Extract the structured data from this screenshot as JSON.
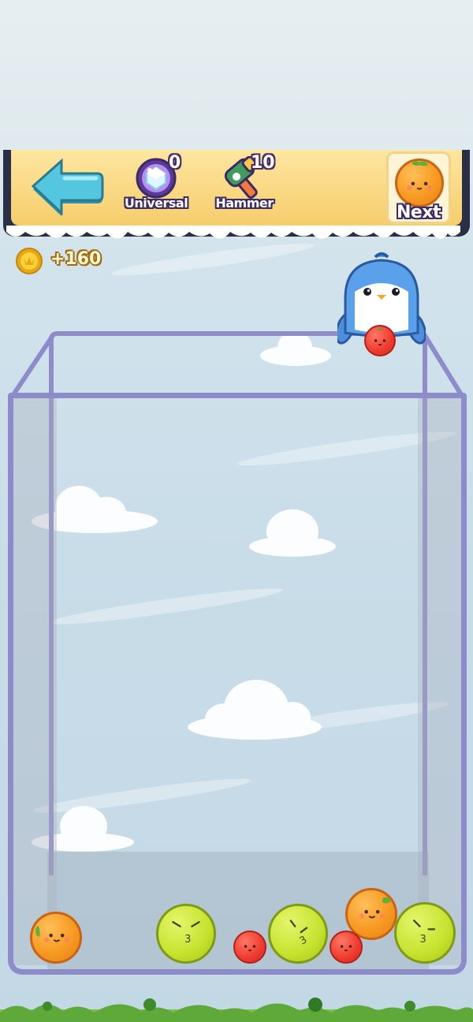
{
  "toolbar": {
    "back_icon": "back-arrow-icon",
    "universal": {
      "label": "Universal",
      "count": "0",
      "icon": "universal-crystal-icon"
    },
    "hammer": {
      "label": "Hammer",
      "count": "10",
      "icon": "hammer-icon"
    },
    "next": {
      "label": "Next",
      "fruit": "orange"
    }
  },
  "score": {
    "value": "+160",
    "icon": "gold-coin-icon"
  },
  "dropper": {
    "character": "penguin",
    "held_fruit": "tomato"
  },
  "colors": {
    "panel": "#f6cd6c",
    "panel_border": "#2b2f45",
    "jar": "#8d8bc9",
    "orange": "#f79a22",
    "tomato": "#ee3b2e",
    "lime": "#c6e22e"
  },
  "fruits_in_jar": [
    "orange",
    "lime",
    "tomato",
    "lime",
    "orange",
    "tomato",
    "lime"
  ]
}
